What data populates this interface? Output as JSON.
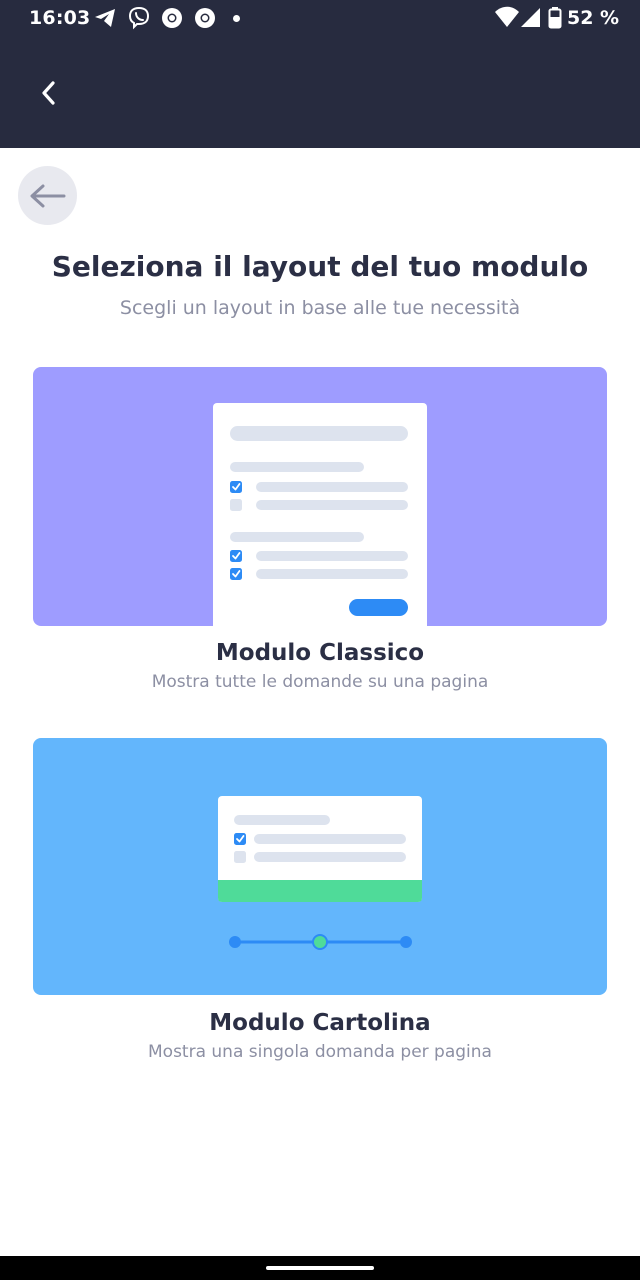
{
  "status_bar": {
    "time": "16:03",
    "battery": "52 %",
    "notification_icons": [
      "telegram-icon",
      "viber-icon",
      "chrome-icon",
      "chrome-icon",
      "more-notifications-dot"
    ],
    "system_icons": [
      "wifi-icon",
      "signal-icon",
      "battery-icon"
    ]
  },
  "header": {
    "back_icon": "chevron-left-icon"
  },
  "page": {
    "back_icon": "arrow-left-icon",
    "title": "Seleziona il layout del tuo modulo",
    "subtitle": "Scegli un layout in base alle tue necessità"
  },
  "layouts": [
    {
      "id": "classic",
      "title": "Modulo Classico",
      "description": "Mostra tutte le domande su una pagina",
      "background": "#9e9cff"
    },
    {
      "id": "card",
      "title": "Modulo Cartolina",
      "description": "Mostra una singola domanda per pagina",
      "background": "#63b6fc"
    }
  ],
  "colors": {
    "header_bg": "#272b3f",
    "title_text": "#2b2f45",
    "muted_text": "#8c8fa3",
    "check_blue": "#2d8bf5",
    "green_accent": "#4fdb99"
  }
}
